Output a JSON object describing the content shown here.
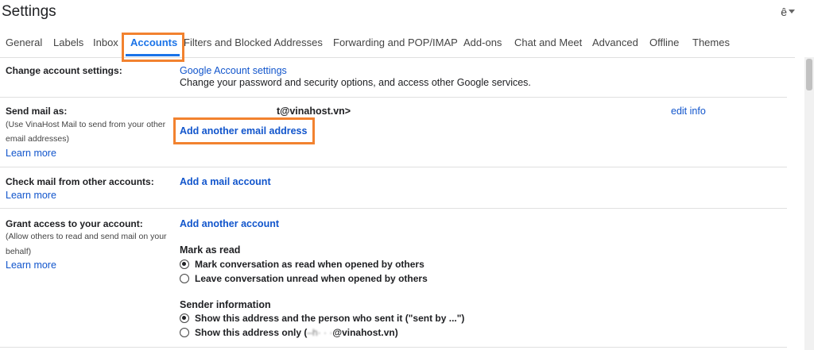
{
  "header": {
    "title": "Settings",
    "input_tools_icon": "ê"
  },
  "tabs": [
    {
      "label": "General"
    },
    {
      "label": "Labels"
    },
    {
      "label": "Inbox"
    },
    {
      "label": "Accounts"
    },
    {
      "label": "Filters and Blocked Addresses"
    },
    {
      "label": "Forwarding and POP/IMAP"
    },
    {
      "label": "Add-ons"
    },
    {
      "label": "Chat and Meet"
    },
    {
      "label": "Advanced"
    },
    {
      "label": "Offline"
    },
    {
      "label": "Themes"
    }
  ],
  "change_account": {
    "label": "Change account settings:",
    "link": "Google Account settings",
    "desc": "Change your password and security options, and access other Google services."
  },
  "send_mail": {
    "label": "Send mail as:",
    "desc_1": "(Use VinaHost Mail to send from your other",
    "desc_2": "email addresses)",
    "learn_more": "Learn more",
    "address": "t@vinahost.vn>",
    "edit_info": "edit info",
    "add_another": "Add another email address"
  },
  "check_mail": {
    "label": "Check mail from other accounts:",
    "learn_more": "Learn more",
    "add_account": "Add a mail account"
  },
  "grant_access": {
    "label": "Grant access to your account:",
    "desc_1": "(Allow others to read and send mail on your",
    "desc_2": "behalf)",
    "learn_more": "Learn more",
    "add_another": "Add another account",
    "mark_as_read": {
      "title": "Mark as read",
      "option_1": "Mark conversation as read when opened by others",
      "option_2": "Leave conversation unread when opened by others"
    },
    "sender_info": {
      "title": "Sender information",
      "option_1": "Show this address and the person who sent it (\"sent by ...\")",
      "option_2_prefix": "Show this address only (",
      "option_2_blur": "–h· · ·",
      "option_2_suffix": "@vinahost.vn)"
    }
  },
  "colors": {
    "accent": "#1a73e8",
    "link": "#1155cc",
    "highlight": "#f2822f"
  }
}
